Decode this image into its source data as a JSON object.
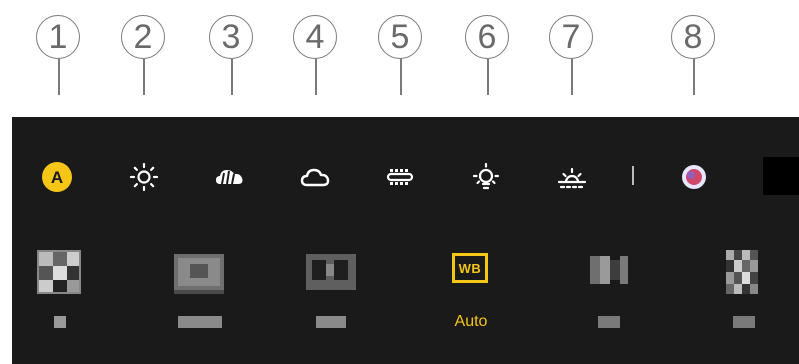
{
  "callouts": [
    "1",
    "2",
    "3",
    "4",
    "5",
    "6",
    "7",
    "8"
  ],
  "wb_modes": [
    {
      "icon": "auto-a-icon",
      "label": "A"
    },
    {
      "icon": "sunny-icon"
    },
    {
      "icon": "cloudy-haze-icon"
    },
    {
      "icon": "cloud-icon"
    },
    {
      "icon": "fluorescent-icon"
    },
    {
      "icon": "incandescent-bulb-icon"
    },
    {
      "icon": "sunset-icon"
    },
    {
      "icon": "custom-color-icon"
    }
  ],
  "selected_tile": {
    "badge": "WB",
    "label": "Auto"
  },
  "colors": {
    "accent": "#f5c518",
    "panel": "#1a1a1a",
    "icon": "#ffffff",
    "custom_outer": "#e7e7ff",
    "custom_inner": "#d0476a"
  }
}
